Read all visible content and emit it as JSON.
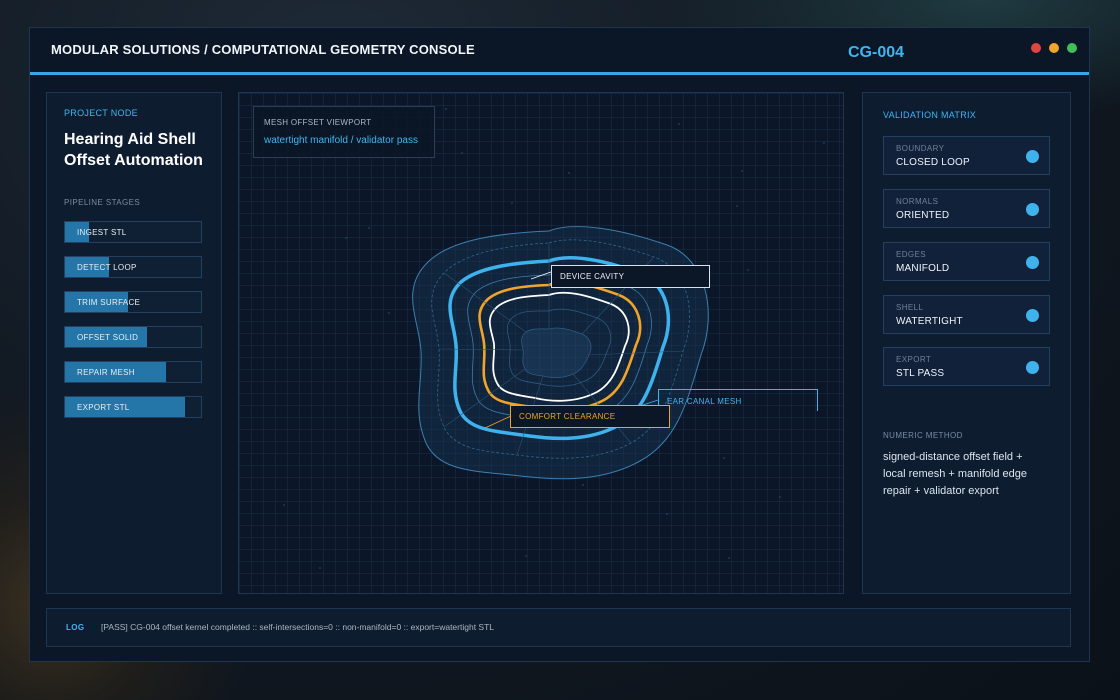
{
  "app": {
    "title": "MODULAR SOLUTIONS / COMPUTATIONAL GEOMETRY CONSOLE",
    "code": "CG-004",
    "window_dots": [
      "#e0453f",
      "#f0a52a",
      "#3fbf5a"
    ]
  },
  "project": {
    "label": "PROJECT NODE",
    "title_line1": "Hearing Aid Shell",
    "title_line2": "Offset Automation",
    "stages_label": "PIPELINE STAGES",
    "stages": [
      {
        "label": "INGEST STL",
        "progress": 0.18
      },
      {
        "label": "DETECT LOOP",
        "progress": 0.32
      },
      {
        "label": "TRIM SURFACE",
        "progress": 0.46
      },
      {
        "label": "OFFSET SOLID",
        "progress": 0.6
      },
      {
        "label": "REPAIR MESH",
        "progress": 0.74
      },
      {
        "label": "EXPORT STL",
        "progress": 0.88
      }
    ]
  },
  "viewport": {
    "title": "MESH OFFSET VIEWPORT",
    "subtitle": "watertight manifold / validator pass",
    "callouts": {
      "device_cavity": "DEVICE CAVITY",
      "comfort_clearance": "COMFORT CLEARANCE",
      "ear_canal_mesh": "EAR CANAL MESH"
    }
  },
  "validation": {
    "label": "VALIDATION MATRIX",
    "items": [
      {
        "key": "BOUNDARY",
        "value": "CLOSED LOOP"
      },
      {
        "key": "NORMALS",
        "value": "ORIENTED"
      },
      {
        "key": "EDGES",
        "value": "MANIFOLD"
      },
      {
        "key": "SHELL",
        "value": "WATERTIGHT"
      },
      {
        "key": "EXPORT",
        "value": "STL PASS"
      }
    ],
    "method_label": "NUMERIC METHOD",
    "method_text": "signed-distance offset field + local remesh + manifold edge repair + validator export"
  },
  "log": {
    "tag": "LOG",
    "message": "[PASS] CG-004 offset kernel completed :: self-intersections=0 :: non-manifold=0 :: export=watertight STL"
  },
  "colors": {
    "accent": "#3fb6f2",
    "orange": "#f0a52a",
    "stage_fill": "#2476a8"
  }
}
